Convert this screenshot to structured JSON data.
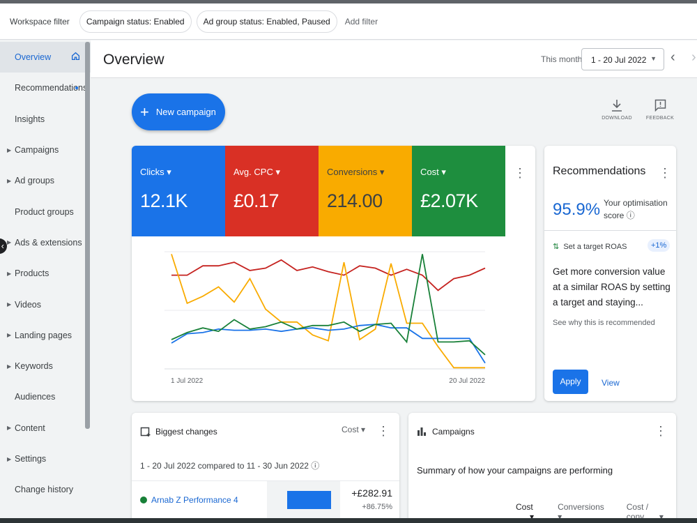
{
  "filters": {
    "label": "Workspace filter",
    "chips": [
      "Campaign status: Enabled",
      "Ad group status: Enabled, Paused"
    ],
    "add": "Add filter"
  },
  "sidebar": {
    "items": [
      {
        "label": "Overview",
        "active": true
      },
      {
        "label": "Recommendations"
      },
      {
        "label": "Insights"
      },
      {
        "label": "Campaigns",
        "expandable": true
      },
      {
        "label": "Ad groups",
        "expandable": true
      },
      {
        "label": "Product groups"
      },
      {
        "label": "Ads & extensions",
        "expandable": true
      },
      {
        "label": "Products",
        "expandable": true
      },
      {
        "label": "Videos",
        "expandable": true
      },
      {
        "label": "Landing pages",
        "expandable": true
      },
      {
        "label": "Keywords",
        "expandable": true
      },
      {
        "label": "Audiences"
      },
      {
        "label": "Content",
        "expandable": true
      },
      {
        "label": "Settings",
        "expandable": true
      },
      {
        "label": "Change history"
      }
    ]
  },
  "header": {
    "title": "Overview",
    "date_label": "This month",
    "date_range": "1 - 20 Jul 2022"
  },
  "actions": {
    "new_campaign": "New campaign",
    "download": "DOWNLOAD",
    "feedback": "FEEDBACK"
  },
  "metrics": [
    {
      "name": "Clicks",
      "value": "12.1K",
      "color": "#1a73e8"
    },
    {
      "name": "Avg. CPC",
      "value": "£0.17",
      "color": "#d93025"
    },
    {
      "name": "Conversions",
      "value": "214.00",
      "color": "#f9ab00"
    },
    {
      "name": "Cost",
      "value": "£2.07K",
      "color": "#1e8e3e"
    }
  ],
  "chart_data": {
    "type": "line",
    "x_start_label": "1 Jul 2022",
    "x_end_label": "20 Jul 2022",
    "grid": true,
    "series": [
      {
        "name": "Avg. CPC",
        "color": "#c5221f",
        "values": [
          80,
          80,
          88,
          88,
          91,
          84,
          86,
          93,
          84,
          87,
          83,
          80,
          88,
          86,
          80,
          85,
          80,
          67,
          77,
          80,
          86
        ]
      },
      {
        "name": "Conversions",
        "color": "#f9ab00",
        "values": [
          98,
          56,
          62,
          70,
          57,
          77,
          51,
          40,
          40,
          29,
          24,
          91,
          25,
          34,
          90,
          39,
          39,
          19,
          1,
          1,
          1
        ]
      },
      {
        "name": "Clicks",
        "color": "#1a73e8",
        "values": [
          22,
          30,
          31,
          34,
          33,
          33,
          34,
          32,
          34,
          35,
          33,
          34,
          37,
          38,
          35,
          35,
          26,
          26,
          26,
          26,
          5
        ]
      },
      {
        "name": "Cost",
        "color": "#188038",
        "values": [
          25,
          31,
          35,
          32,
          42,
          34,
          36,
          40,
          34,
          37,
          37,
          40,
          32,
          38,
          39,
          23,
          98,
          23,
          23,
          24,
          12
        ]
      }
    ]
  },
  "recommendations": {
    "title": "Recommendations",
    "score": "95.9%",
    "score_label": "Your optimisation score",
    "item_title": "Set a target ROAS",
    "badge": "+1%",
    "body": "Get more conversion value at a similar ROAS by setting a target and staying...",
    "why": "See why this is recommended",
    "apply": "Apply",
    "view": "View"
  },
  "biggest_changes": {
    "title": "Biggest changes",
    "metric": "Cost",
    "subtitle": "1 - 20 Jul 2022 compared to 11 - 30 Jun 2022",
    "rows": [
      {
        "name": "Arnab Z Performance 4",
        "value": "+£282.91",
        "pct": "+86.75%",
        "bar_fraction": 0.6
      }
    ]
  },
  "campaigns": {
    "title": "Campaigns",
    "summary": "Summary of how your campaigns are performing",
    "columns": [
      "Cost",
      "Conversions",
      "Cost / conv."
    ]
  }
}
